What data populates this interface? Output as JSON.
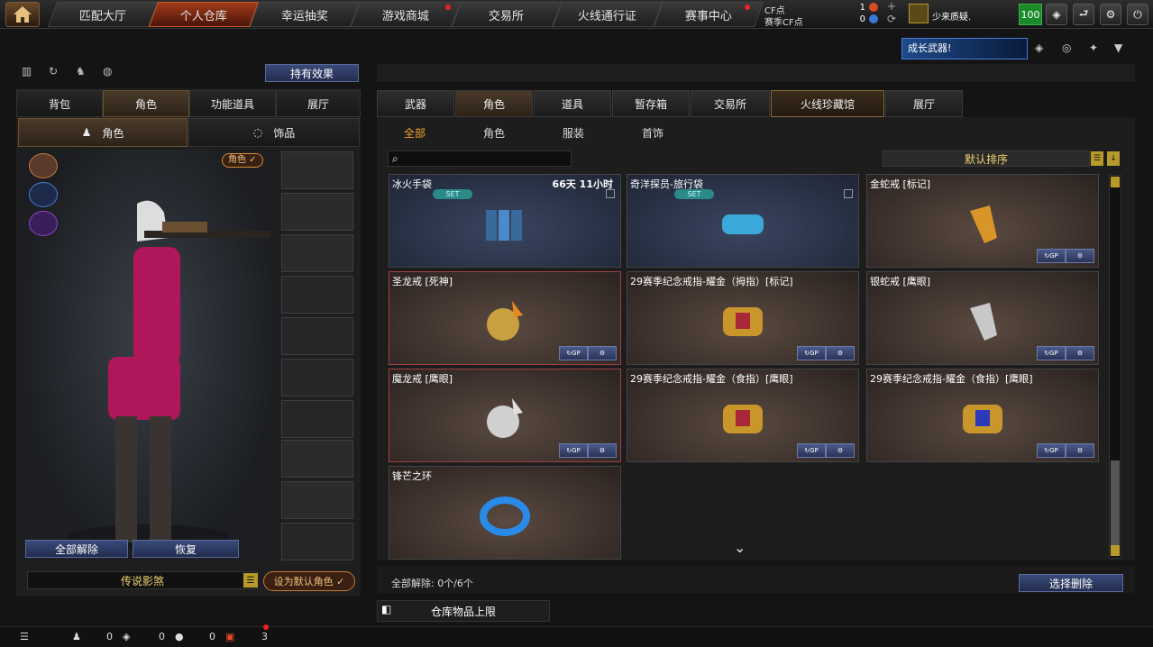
{
  "top_nav": {
    "tabs": [
      {
        "label": "匹配大厅",
        "active": false,
        "badge": false
      },
      {
        "label": "个人仓库",
        "active": true,
        "badge": false
      },
      {
        "label": "幸运抽奖",
        "active": false,
        "badge": false
      },
      {
        "label": "游戏商城",
        "active": false,
        "badge": true
      },
      {
        "label": "交易所",
        "active": false,
        "badge": false
      },
      {
        "label": "火线通行证",
        "active": false,
        "badge": false
      },
      {
        "label": "赛事中心",
        "active": false,
        "badge": true
      }
    ],
    "cf_label": "CF点",
    "cf_value": "1",
    "match_cf_label": "赛季CF点",
    "match_cf_value": "0",
    "username": "少来质疑.",
    "level": "100"
  },
  "left_panel": {
    "hold_effect_label": "持有效果",
    "tabs": [
      "背包",
      "角色",
      "功能道具",
      "展厅"
    ],
    "active_tab": "角色",
    "subtabs": [
      "角色",
      "饰品"
    ],
    "char_badge": "角色 ✓",
    "clear_all_label": "全部解除",
    "restore_label": "恢复",
    "character_name": "传说影煞",
    "set_default_label": "设为默认角色 ✓"
  },
  "right_panel": {
    "banner_text": "成长武器!",
    "tabs": [
      "武器",
      "角色",
      "道具",
      "暂存箱",
      "交易所",
      "火线珍藏馆",
      "展厅"
    ],
    "subtabs": [
      "全部",
      "角色",
      "服装",
      "首饰"
    ],
    "active_subtab": "全部",
    "search_placeholder": "",
    "sort_label": "默认排序",
    "items": [
      {
        "name": "冰火手袋",
        "time": "66天 11小时",
        "set": "SET",
        "style": "blue"
      },
      {
        "name": "奇洋探员-旅行袋",
        "time": "",
        "set": "SET",
        "style": "blue"
      },
      {
        "name": "金蛇戒 [标记]",
        "time": "",
        "set": "",
        "style": "brown"
      },
      {
        "name": "圣龙戒 [死神]",
        "time": "",
        "set": "",
        "style": "brown red"
      },
      {
        "name": "29赛季纪念戒指-耀金（拇指）[标记]",
        "time": "",
        "set": "",
        "style": "brown"
      },
      {
        "name": "银蛇戒 [鹰眼]",
        "time": "",
        "set": "",
        "style": "brown"
      },
      {
        "name": "魔龙戒 [鹰眼]",
        "time": "",
        "set": "",
        "style": "brown red"
      },
      {
        "name": "29赛季纪念戒指-耀金（食指）[鹰眼]",
        "time": "",
        "set": "",
        "style": "brown"
      },
      {
        "name": "29赛季纪念戒指-耀金（食指）[鹰眼]",
        "time": "",
        "set": "",
        "style": "brown"
      },
      {
        "name": "锋芒之环",
        "time": "",
        "set": "",
        "style": "brown"
      }
    ],
    "clear_status": "全部解除: 0个/6个",
    "select_delete_label": "选择删除",
    "storage_limit_label": "仓库物品上限"
  },
  "bottom_bar": {
    "count1": "0",
    "count2": "0",
    "count3": "0",
    "count4": "3"
  },
  "colors": {
    "accent": "#f3a534",
    "active_tab_red": "#a23a1a",
    "button_blue": "#3a4a7a",
    "set_teal": "#2a8a88"
  }
}
